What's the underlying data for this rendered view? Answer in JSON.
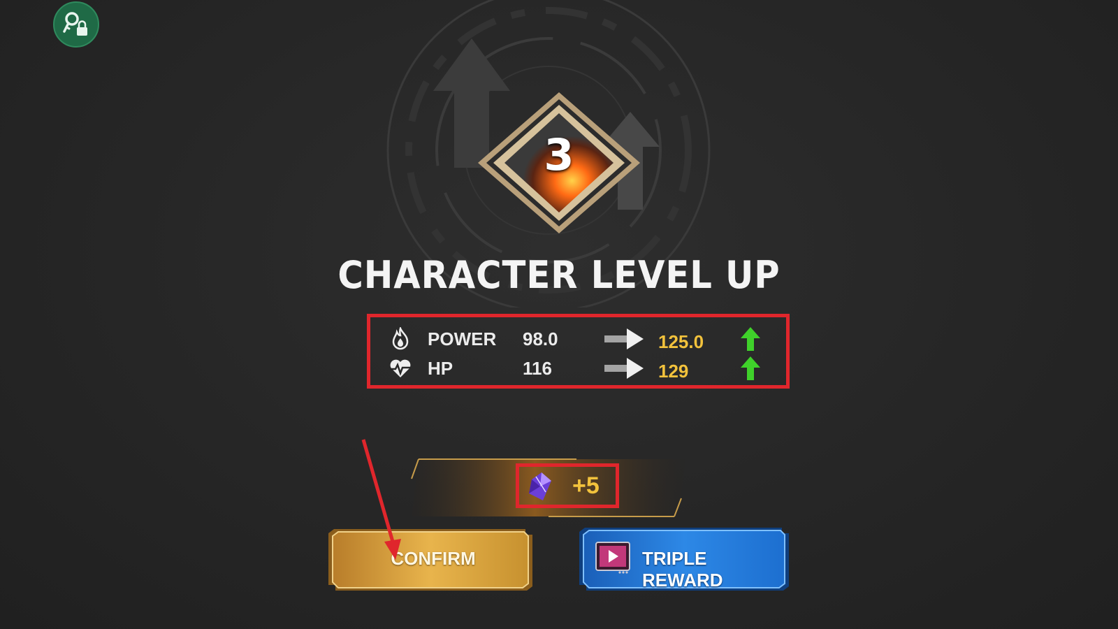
{
  "header": {
    "key_icon": "key-lock-icon"
  },
  "level_badge": {
    "level": "3"
  },
  "title": "CHARACTER LEVEL UP",
  "stats": [
    {
      "icon": "flame-icon",
      "name": "POWER",
      "old": "98.0",
      "new": "125.0",
      "trend": "up-arrow-icon"
    },
    {
      "icon": "heartbeat-icon",
      "name": "HP",
      "old": "116",
      "new": "129",
      "trend": "up-arrow-icon"
    }
  ],
  "reward": {
    "icon": "purple-gem-icon",
    "amount": "+5"
  },
  "buttons": {
    "confirm_label": "CONFIRM",
    "triple_label": "TRIPLE REWARD",
    "triple_icon": "video-play-icon"
  },
  "colors": {
    "highlight_box": "#e0262c",
    "gold_value": "#f2c23c",
    "up_arrow": "#3fd12a",
    "confirm_gold": "#d9a23a",
    "triple_blue": "#1d6fd0"
  }
}
